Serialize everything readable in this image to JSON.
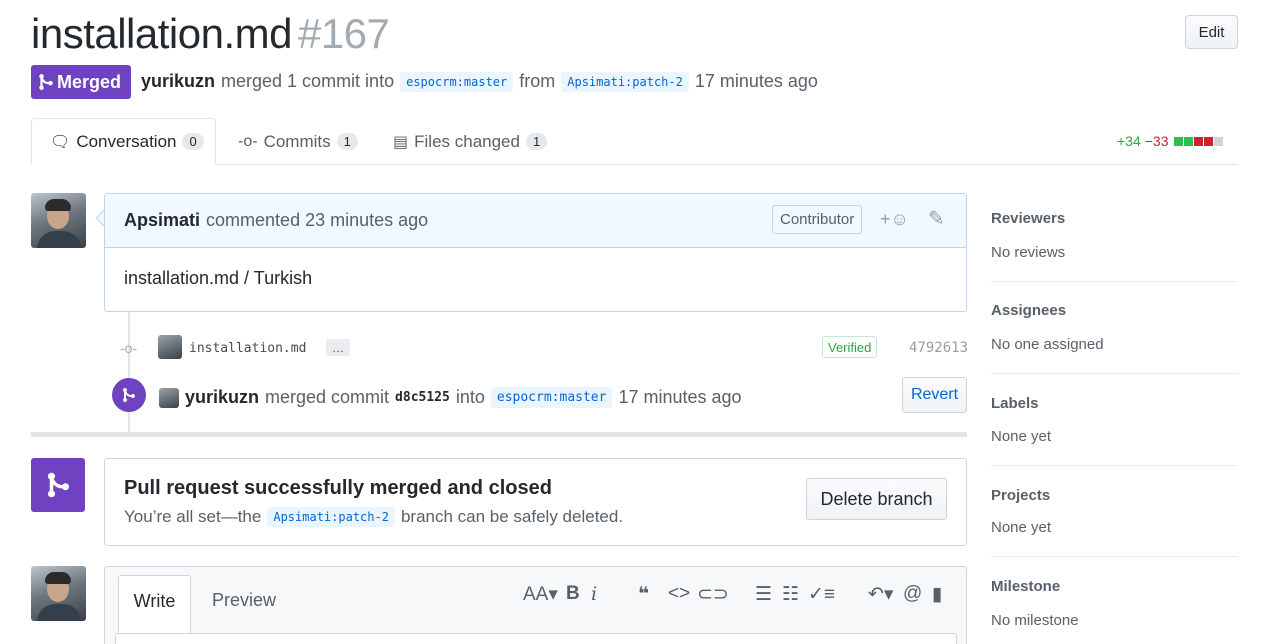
{
  "header": {
    "title": "installation.md",
    "number": "#167",
    "edit_label": "Edit",
    "state_label": "Merged",
    "merger": "yurikuzn",
    "merge_text": "merged 1 commit into",
    "base_branch": "espocrm:master",
    "from_text": "from",
    "head_branch": "Apsimati:patch-2",
    "time": "17 minutes ago"
  },
  "tabs": [
    {
      "label": "Conversation",
      "count": "0"
    },
    {
      "label": "Commits",
      "count": "1"
    },
    {
      "label": "Files changed",
      "count": "1"
    }
  ],
  "diffstat": {
    "additions": "+34",
    "deletions": "−33"
  },
  "comment": {
    "author": "Apsimati",
    "meta": "commented 23 minutes ago",
    "role": "Contributor",
    "body": "installation.md / Turkish"
  },
  "commit": {
    "message": "installation.md",
    "ellipsis": "…",
    "verified": "Verified",
    "sha": "4792613"
  },
  "merge_event": {
    "user": "yurikuzn",
    "text1": "merged commit",
    "commit": "d8c5125",
    "text2": "into",
    "branch": "espocrm:master",
    "time": "17 minutes ago",
    "revert_label": "Revert"
  },
  "merged_box": {
    "title": "Pull request successfully merged and closed",
    "desc1": "You’re all set—the",
    "branch": "Apsimati:patch-2",
    "desc2": "branch can be safely deleted.",
    "delete_label": "Delete branch"
  },
  "composer": {
    "write_label": "Write",
    "preview_label": "Preview"
  },
  "sidebar": [
    {
      "heading": "Reviewers",
      "value": "No reviews"
    },
    {
      "heading": "Assignees",
      "value": "No one assigned"
    },
    {
      "heading": "Labels",
      "value": "None yet"
    },
    {
      "heading": "Projects",
      "value": "None yet"
    },
    {
      "heading": "Milestone",
      "value": "No milestone"
    }
  ],
  "colors": {
    "merged_purple": "#6f42c1",
    "link_blue": "#0366d6",
    "add_green": "#28a745",
    "del_red": "#cb2431"
  }
}
